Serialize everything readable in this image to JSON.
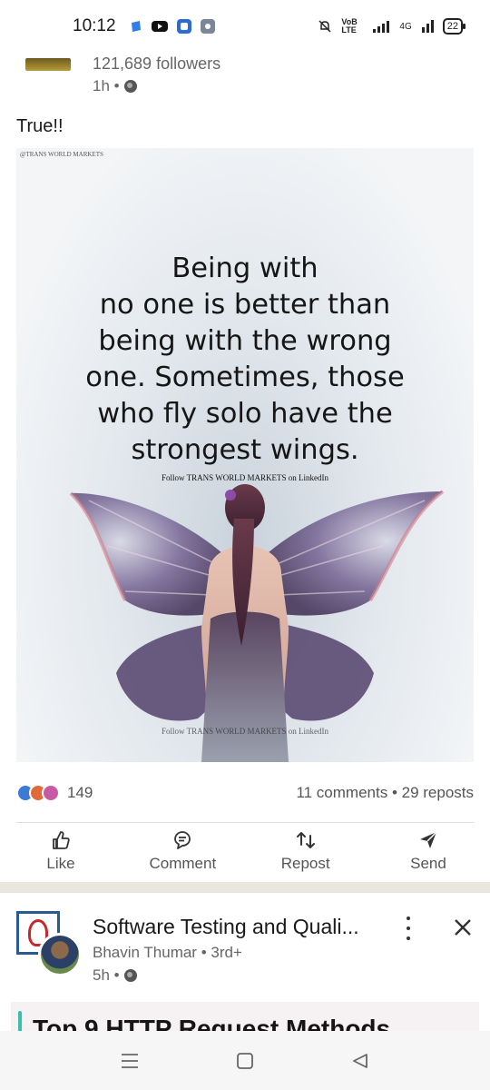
{
  "status_bar": {
    "time": "10:12",
    "network_label": "4G",
    "volte_label": "VoB LTE",
    "battery": "22"
  },
  "post": {
    "followers": "121,689 followers",
    "time": "1h •",
    "text": "True!!",
    "image": {
      "watermark_top": "@TRANS WORLD MARKETS",
      "quote": "Being with\nno one is better than\nbeing with the wrong\none. Sometimes, those\nwho fly solo have the\nstrongest wings.",
      "follow_line": "Follow TRANS WORLD MARKETS on LinkedIn",
      "watermark_bottom": "Follow TRANS WORLD MARKETS on LinkedIn"
    },
    "reaction_count": "149",
    "comments_reposts": "11 comments • 29 reposts",
    "actions": {
      "like": "Like",
      "comment": "Comment",
      "repost": "Repost",
      "send": "Send"
    }
  },
  "post2": {
    "group_name": "Software Testing and Quali...",
    "author": "Bhavin Thumar • 3rd+",
    "time": "5h •",
    "article_title": "Top 9 HTTP Request Methods"
  },
  "colors": {
    "accent_blue": "#3b7bd6",
    "feed_gap": "#e8e6df",
    "text_secondary": "#666666"
  }
}
